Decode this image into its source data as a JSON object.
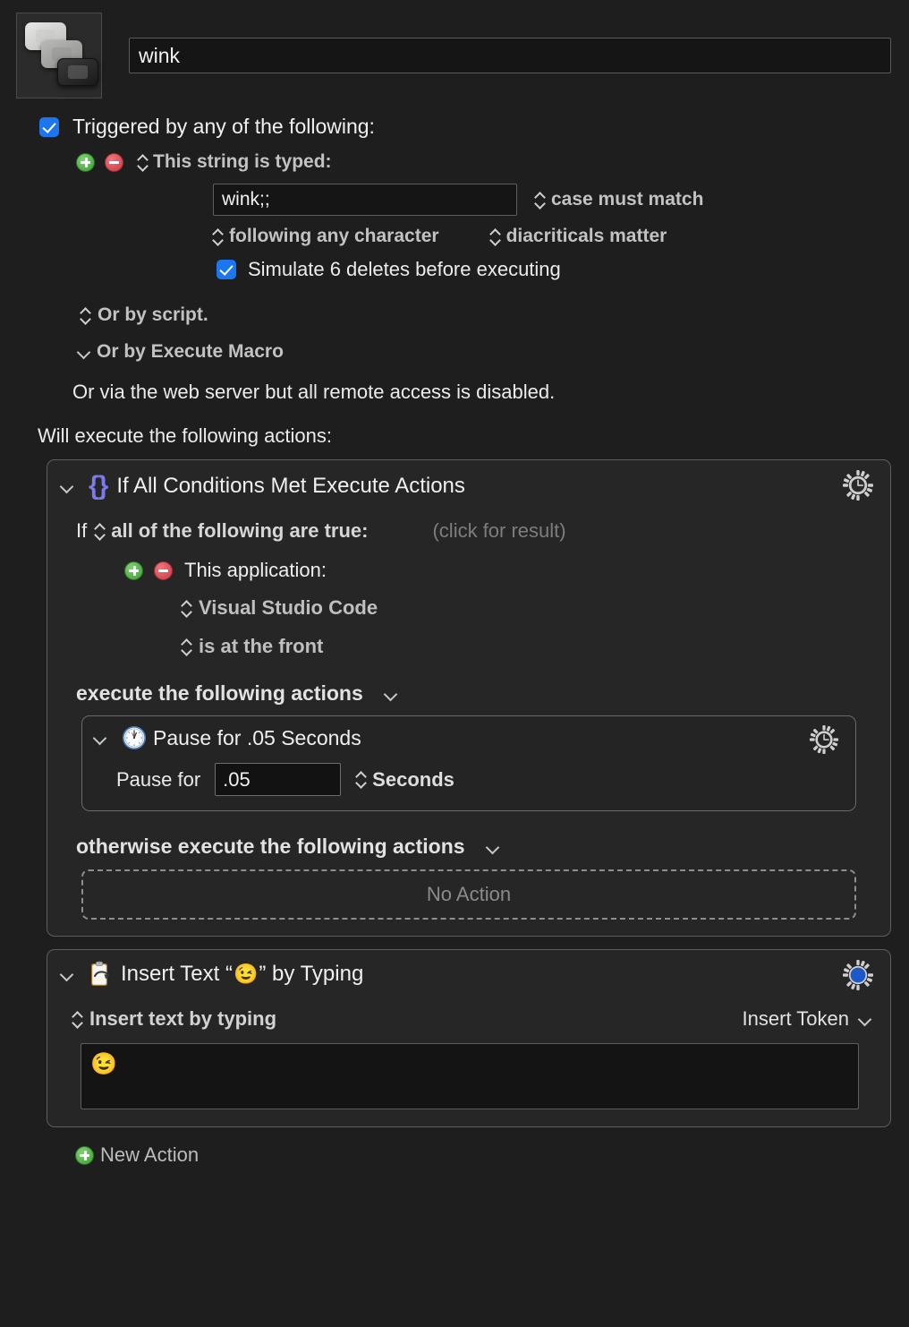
{
  "macro": {
    "icon_name": "typed-string-macro-icon",
    "name_value": "wink"
  },
  "trigger": {
    "enabled_label": "Triggered by any of the following:",
    "type_label": "This string is typed:",
    "string_value": "wink;;",
    "case_option": "case must match",
    "following_option": "following any character",
    "diacriticals_option": "diacriticals matter",
    "simulate_deletes_label": "Simulate 6 deletes before executing",
    "or_by_script": "Or by script.",
    "or_by_execute_macro": "Or by Execute Macro",
    "web_server_note": "Or via the web server but all remote access is disabled."
  },
  "actions_intro": "Will execute the following actions:",
  "if_action": {
    "title": "If All Conditions Met Execute Actions",
    "if_word": "If",
    "condition_mode": "all of the following are true:",
    "click_for_result": "(click for result)",
    "condition": {
      "label": "This application:",
      "app": "Visual Studio Code",
      "state": "is at the front"
    },
    "then_label": "execute the following actions",
    "otherwise_label": "otherwise execute the following actions",
    "no_action_label": "No Action",
    "nested_action": {
      "title": "Pause for .05 Seconds",
      "pause_for_label": "Pause for",
      "pause_value": ".05",
      "units": "Seconds"
    }
  },
  "insert_text_action": {
    "title_prefix": "Insert Text “",
    "title_emoji": "😉",
    "title_suffix": "” by Typing",
    "mode_label": "Insert text by typing",
    "insert_token_label": "Insert Token",
    "text_value": "😉"
  },
  "new_action_label": "New Action",
  "colors": {
    "background": "#1e1e1e",
    "panel": "#262626",
    "checkbox_blue": "#1b76ef",
    "add_green": "#4ba43f",
    "remove_red": "#d0444e",
    "braces_purple": "#7b7bea",
    "gear_blue": "#1e58c8",
    "field_background": "#151515",
    "border": "#5e5e5e"
  }
}
